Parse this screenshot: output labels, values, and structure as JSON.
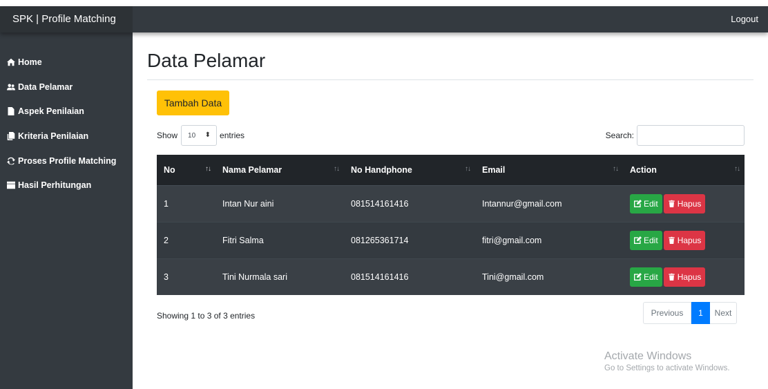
{
  "header": {
    "brand": "SPK | Profile Matching",
    "logout_label": "Logout"
  },
  "sidebar": {
    "items": [
      {
        "label": "Home",
        "icon": "home-icon"
      },
      {
        "label": "Data Pelamar",
        "icon": "users-icon"
      },
      {
        "label": "Aspek Penilaian",
        "icon": "file-icon"
      },
      {
        "label": "Kriteria Penilaian",
        "icon": "copy-icon"
      },
      {
        "label": "Proses Profile Matching",
        "icon": "sync-icon"
      },
      {
        "label": "Hasil Perhitungan",
        "icon": "table-icon"
      }
    ]
  },
  "main": {
    "title": "Data Pelamar",
    "add_button_label": "Tambah Data",
    "show_label": "Show",
    "entries_count": "10",
    "entries_label": "entries",
    "search_label": "Search:",
    "search_value": ""
  },
  "table": {
    "columns": [
      "No",
      "Nama Pelamar",
      "No Handphone",
      "Email",
      "Action"
    ],
    "rows": [
      {
        "no": "1",
        "nama": "Intan Nur aini",
        "hp": "081514161416",
        "email": "Intannur@gmail.com"
      },
      {
        "no": "2",
        "nama": "Fitri Salma",
        "hp": "081265361714",
        "email": "fitri@gmail.com"
      },
      {
        "no": "3",
        "nama": "Tini Nurmala sari",
        "hp": "081514161416",
        "email": "Tini@gmail.com"
      }
    ],
    "edit_label": "Edit",
    "hapus_label": "Hapus"
  },
  "footer": {
    "info": "Showing 1 to 3 of 3 entries",
    "previous_label": "Previous",
    "current_page": "1",
    "next_label": "Next"
  },
  "watermark": {
    "title": "Activate Windows",
    "subtitle": "Go to Settings to activate Windows."
  },
  "colors": {
    "sidebar": "#343a40",
    "add_button": "#ffc107",
    "edit_button": "#28a745",
    "hapus_button": "#dc3545",
    "current_page": "#007bff"
  }
}
